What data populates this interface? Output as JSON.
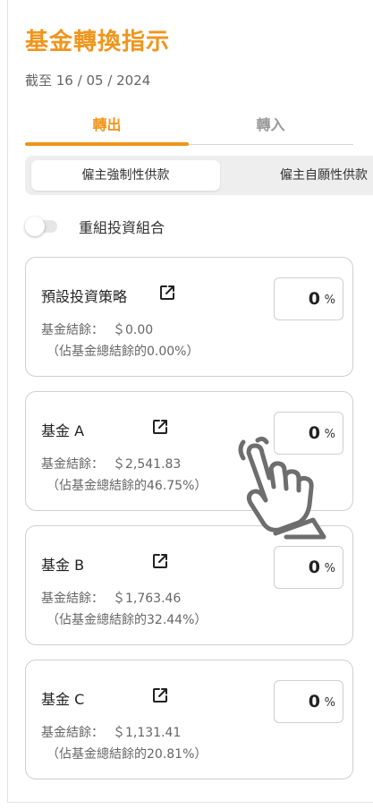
{
  "page": {
    "title": "基金轉換指示",
    "date": "截至 16 / 05 / 2024"
  },
  "tabs": [
    {
      "label": "轉出",
      "active": true
    },
    {
      "label": "轉入",
      "active": false
    }
  ],
  "segments": [
    {
      "label": "僱主強制性供款",
      "active": true
    },
    {
      "label": "僱主自願性供款",
      "active": false
    }
  ],
  "toggle": {
    "label": "重組投資組合",
    "on": false
  },
  "funds": [
    {
      "name": "預設投資策略",
      "balance_label": "基金結餘：",
      "balance": "＄0.00",
      "share": "（佔基金總結餘的0.00%）",
      "percent": "0",
      "percent_sign": "%"
    },
    {
      "name": "基金 A",
      "balance_label": "基金結餘：",
      "balance": "＄2,541.83",
      "share": "（佔基金總結餘的46.75%）",
      "percent": "0",
      "percent_sign": "%"
    },
    {
      "name": "基金 B",
      "balance_label": "基金結餘：",
      "balance": "＄1,763.46",
      "share": "（佔基金總結餘的32.44%）",
      "percent": "0",
      "percent_sign": "%"
    },
    {
      "name": "基金 C",
      "balance_label": "基金結餘：",
      "balance": "＄1,131.41",
      "share": "（佔基金總結餘的20.81%）",
      "percent": "0",
      "percent_sign": "%"
    }
  ],
  "colors": {
    "accent": "#f0951c",
    "border": "#cfcfcf"
  },
  "icons": {
    "open": "external-link-icon",
    "pointer": "hand-pointer-icon"
  }
}
